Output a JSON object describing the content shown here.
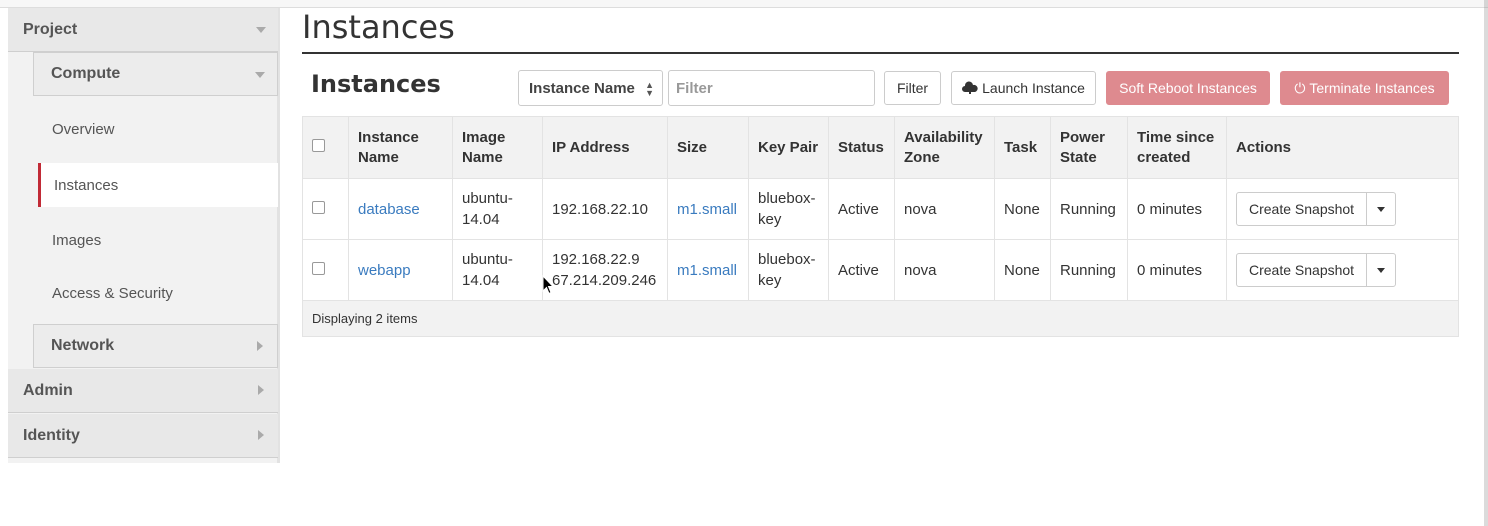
{
  "sidebar": {
    "project": "Project",
    "compute": "Compute",
    "items": [
      {
        "label": "Overview"
      },
      {
        "label": "Instances"
      },
      {
        "label": "Images"
      },
      {
        "label": "Access & Security"
      }
    ],
    "network": "Network",
    "admin": "Admin",
    "identity": "Identity"
  },
  "main": {
    "page_title": "Instances",
    "table_title": "Instances",
    "filter_select": "Instance Name",
    "filter_placeholder": "Filter",
    "filter_button": "Filter",
    "launch_button": "Launch Instance",
    "soft_reboot_button": "Soft Reboot Instances",
    "terminate_button": "Terminate Instances"
  },
  "table": {
    "headers": [
      "Instance Name",
      "Image Name",
      "IP Address",
      "Size",
      "Key Pair",
      "Status",
      "Availability Zone",
      "Task",
      "Power State",
      "Time since created",
      "Actions"
    ],
    "rows": [
      {
        "name": "database",
        "image": "ubuntu-14.04",
        "ip1": "192.168.22.10",
        "ip2": "",
        "size": "m1.small",
        "keypair": "bluebox-key",
        "status": "Active",
        "zone": "nova",
        "task": "None",
        "power": "Running",
        "time": "0 minutes",
        "action": "Create Snapshot"
      },
      {
        "name": "webapp",
        "image": "ubuntu-14.04",
        "ip1": "192.168.22.9",
        "ip2": "67.214.209.246",
        "size": "m1.small",
        "keypair": "bluebox-key",
        "status": "Active",
        "zone": "nova",
        "task": "None",
        "power": "Running",
        "time": "0 minutes",
        "action": "Create Snapshot"
      }
    ],
    "footer": "Displaying 2 items"
  },
  "colors": {
    "active_accent": "#c12a36",
    "link": "#3a7bbf",
    "danger_button": "#de8a8f"
  }
}
